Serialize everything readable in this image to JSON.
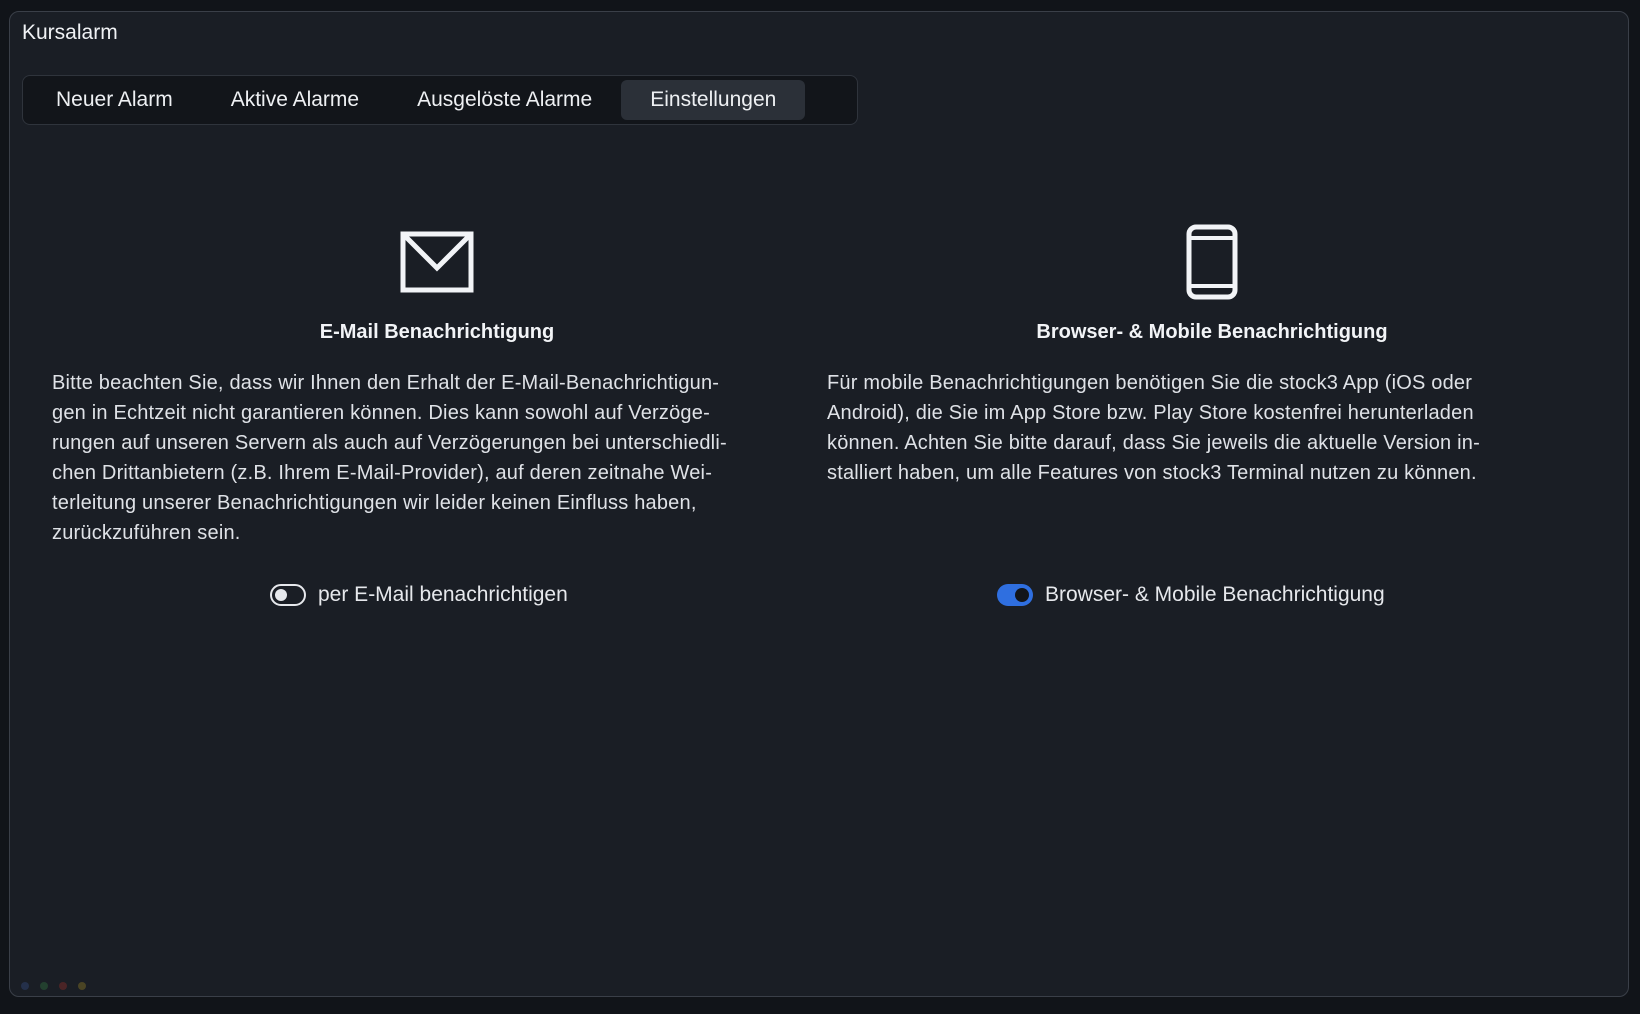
{
  "window": {
    "title": "Kursalarm"
  },
  "tabs": [
    {
      "label": "Neuer Alarm",
      "active": false
    },
    {
      "label": "Aktive Alarme",
      "active": false
    },
    {
      "label": "Ausgelöste Alarme",
      "active": false
    },
    {
      "label": "Einstellungen",
      "active": true
    }
  ],
  "email": {
    "icon": "envelope-icon",
    "heading": "E-Mail Benachrichtigung",
    "lines": [
      "Bitte beachten Sie, dass wir Ihnen den Erhalt der E-Mail-Benachrichtigun-",
      "gen in Echtzeit nicht garantieren können. Dies kann sowohl auf Verzöge-",
      "rungen auf unseren Servern als auch auf Verzögerungen bei unterschiedli-",
      "chen Drittanbietern (z.B. Ihrem E-Mail-Provider), auf deren zeitnahe Wei-",
      "terleitung unserer Benachrichtigungen wir leider keinen Einfluss haben,",
      "zurückzuführen sein."
    ],
    "toggle_label": "per E-Mail benachrichtigen",
    "toggle_on": false
  },
  "mobile": {
    "icon": "smartphone-icon",
    "heading": "Browser- & Mobile Benachrichtigung",
    "lines": [
      "Für mobile Benachrichtigungen benötigen Sie die stock3 App (iOS oder",
      "Android), die Sie im App Store bzw. Play Store kostenfrei herunterladen",
      "können. Achten Sie bitte darauf, dass Sie jeweils die aktuelle Version in-",
      "stalliert haben, um alle Features von stock3 Terminal nutzen zu können."
    ],
    "toggle_label": "Browser- & Mobile Benachrichtigung",
    "toggle_on": true
  },
  "colors": {
    "accent": "#2f6fe0",
    "background": "#1a1e25",
    "dot_colors": [
      "#24304a",
      "#23402f",
      "#4a2426",
      "#4a4424"
    ]
  }
}
